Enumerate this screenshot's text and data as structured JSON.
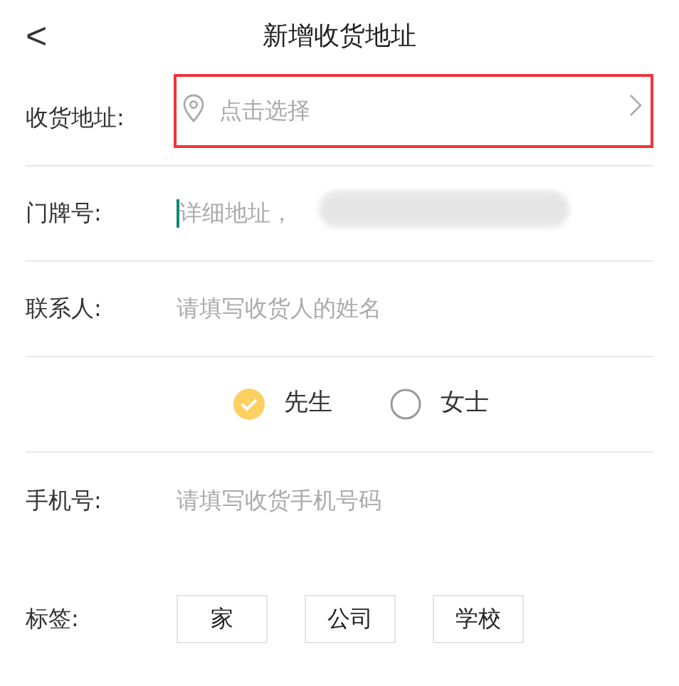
{
  "header": {
    "back": "<",
    "title": "新增收货地址"
  },
  "fields": [
    {
      "kind": "picker",
      "label": "收货地址:",
      "placeholder": "点击选择",
      "highlighted": true
    },
    {
      "kind": "text",
      "label": "门牌号:",
      "placeholder": "详细地址，",
      "focused": true,
      "redacted": true
    },
    {
      "kind": "text",
      "label": "联系人:",
      "placeholder": "请填写收货人的姓名"
    },
    {
      "kind": "gender",
      "options": [
        {
          "label": "先生",
          "selected": true
        },
        {
          "label": "女士",
          "selected": false
        }
      ]
    },
    {
      "kind": "text",
      "label": "手机号:",
      "placeholder": "请填写收货手机号码"
    }
  ],
  "tags": {
    "label": "标签:",
    "items": [
      "家",
      "公司",
      "学校"
    ]
  }
}
